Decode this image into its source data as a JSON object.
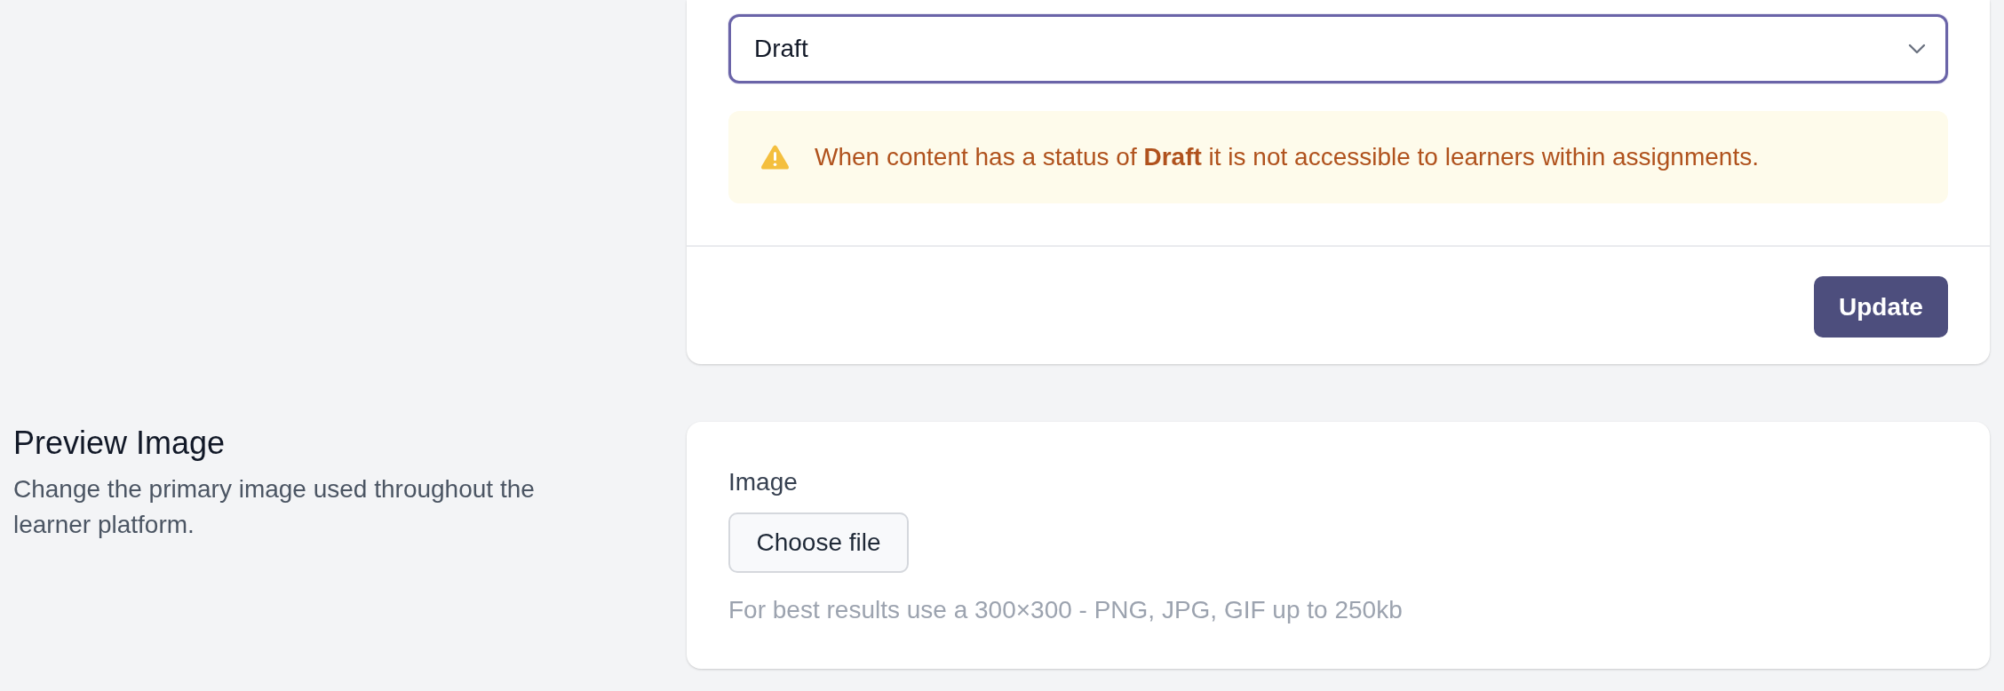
{
  "status_card": {
    "select": {
      "value": "Draft",
      "focused": true
    },
    "alert": {
      "kind": "warning",
      "text": "When content has a status of **Draft** it is not accessible to learners within assignments."
    },
    "update_button": "Update"
  },
  "preview_image": {
    "title": "Preview Image",
    "description": "Change the primary image used throughout the learner platform.",
    "field": {
      "label": "Image",
      "button": "Choose file",
      "help": "For best results use a 300×300 - PNG, JPG, GIF up to 250kb"
    }
  }
}
